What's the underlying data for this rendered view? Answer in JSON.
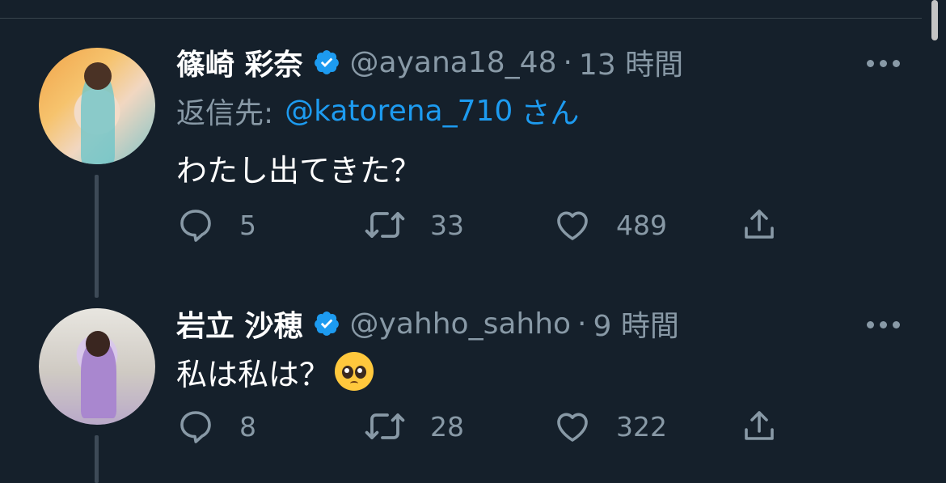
{
  "tweets": [
    {
      "name": "篠崎 彩奈",
      "handle": "@ayana18_48",
      "separator": "·",
      "time": "13 時間",
      "reply_label": "返信先:",
      "reply_mention": "@katorena_710",
      "reply_suffix": "さん",
      "text": "わたし出てきた？",
      "replies": "5",
      "retweets": "33",
      "likes": "489"
    },
    {
      "name": "岩立 沙穂",
      "handle": "@yahho_sahho",
      "separator": "·",
      "time": "9 時間",
      "text": "私は私は？",
      "emoji": "pleading-face-emoji",
      "replies": "8",
      "retweets": "28",
      "likes": "322"
    }
  ],
  "colors": {
    "background": "#15202b",
    "secondary_text": "#8899a6",
    "link": "#1d9bf0",
    "verified": "#1d9bf0"
  },
  "icons": [
    "verified-badge-icon",
    "more-icon",
    "reply-icon",
    "retweet-icon",
    "like-icon",
    "share-icon"
  ]
}
